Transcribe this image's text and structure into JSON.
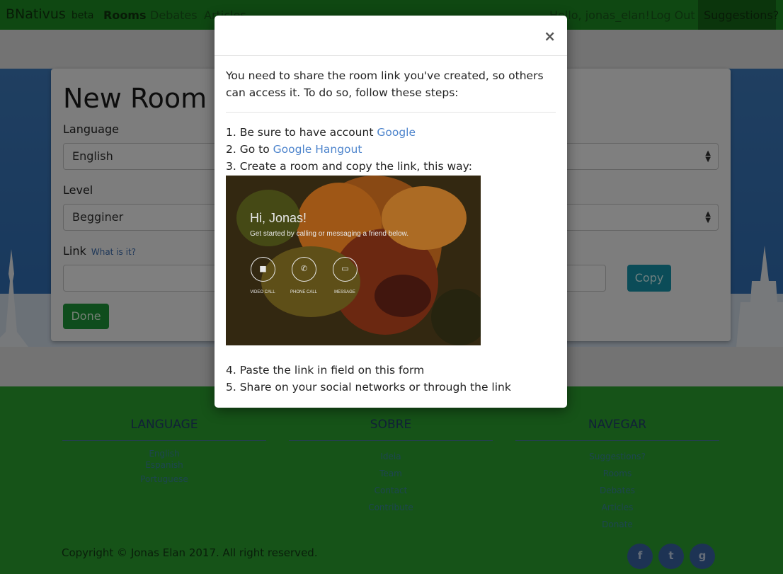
{
  "navbar": {
    "brand": "BNativus",
    "brand_suffix": "beta",
    "links": [
      {
        "label": "Rooms",
        "active": true
      },
      {
        "label": "Debates",
        "active": false
      },
      {
        "label": "Articles",
        "active": false
      }
    ],
    "greeting": "Hello, jonas_elan!",
    "logout": "Log Out",
    "suggestions": "Suggestions?"
  },
  "form": {
    "title": "New Room",
    "language_label": "Language",
    "language_value": "English",
    "level_label": "Level",
    "level_value": "Begginer",
    "link_label": "Link",
    "link_help": "What is it?",
    "link_value": "",
    "copy_label": "Copy",
    "done_label": "Done"
  },
  "modal": {
    "close_symbol": "×",
    "intro": "You need to share the room link you've created, so others can access it. To do so, follow these steps:",
    "step1_text": "1. Be sure to have account ",
    "step1_link": "Google",
    "step2_text": "2. Go to ",
    "step2_link": "Google Hangout",
    "step3": "3. Create a room and copy the link, this way:",
    "screenshot": {
      "greeting": "Hi, Jonas!",
      "subtitle": "Get started by calling or messaging a friend below.",
      "buttons": [
        {
          "icon": "video-camera-icon",
          "label": "VIDEO CALL"
        },
        {
          "icon": "phone-icon",
          "label": "PHONE CALL"
        },
        {
          "icon": "message-icon",
          "label": "MESSAGE"
        }
      ]
    },
    "step4": "4. Paste the link in field on this form",
    "step5": "5. Share on your social networks or through the link"
  },
  "footer": {
    "columns": [
      {
        "title": "LANGUAGE",
        "links": [
          "English",
          "Espanish",
          "Portuguese"
        ]
      },
      {
        "title": "SOBRE",
        "links": [
          "Ideia",
          "Team",
          "Contact",
          "Contribute"
        ]
      },
      {
        "title": "NAVEGAR",
        "links": [
          "Suggestions?",
          "Rooms",
          "Debates",
          "Articles",
          "Donate"
        ]
      }
    ],
    "copyright": "Copyright © Jonas Elan 2017. All right reserved.",
    "social": [
      {
        "icon": "facebook-icon",
        "glyph": "f"
      },
      {
        "icon": "twitter-icon",
        "glyph": "t"
      },
      {
        "icon": "github-icon",
        "glyph": "g"
      }
    ]
  },
  "colors": {
    "navbar": "#1f9124",
    "footer": "#2ca730",
    "hero": "#3f7ec2",
    "copy_button": "#1799b0",
    "done_button": "#1e9a3a",
    "link": "#4d84cc"
  }
}
